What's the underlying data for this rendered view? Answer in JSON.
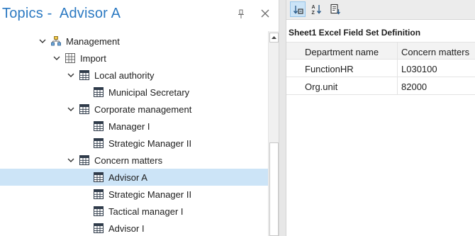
{
  "left_pane": {
    "title": "Topics -  Advisor A",
    "pin_icon": "pin-icon",
    "close_icon": "close-icon"
  },
  "tree": [
    {
      "label": "Management",
      "icon": "org-chart-icon",
      "expanded": true,
      "level": 0
    },
    {
      "label": "Import",
      "icon": "grid-icon",
      "expanded": true,
      "level": 1
    },
    {
      "label": "Local authority",
      "icon": "table-icon",
      "expanded": true,
      "level": 2
    },
    {
      "label": "Municipal Secretary",
      "icon": "table-icon",
      "level": 3
    },
    {
      "label": "Corporate management",
      "icon": "table-icon",
      "expanded": true,
      "level": 2
    },
    {
      "label": "Manager I",
      "icon": "table-icon",
      "level": 3
    },
    {
      "label": "Strategic Manager II",
      "icon": "table-icon",
      "level": 3
    },
    {
      "label": "Concern matters",
      "icon": "table-icon",
      "expanded": true,
      "level": 2
    },
    {
      "label": "Advisor A",
      "icon": "table-icon",
      "level": 3,
      "selected": true
    },
    {
      "label": "Strategic Manager II",
      "icon": "table-icon",
      "level": 3
    },
    {
      "label": "Tactical manager I",
      "icon": "table-icon",
      "level": 3
    },
    {
      "label": "Advisor I",
      "icon": "table-icon",
      "level": 3
    }
  ],
  "toolbar": {
    "buttons": [
      {
        "icon": "categorized-sort-icon",
        "active": true
      },
      {
        "icon": "alphabetical-sort-icon"
      },
      {
        "icon": "property-pages-icon"
      }
    ]
  },
  "properties": {
    "caption": "Sheet1 Excel Field Set Definition",
    "header": [
      "Department name",
      "Concern matters"
    ],
    "rows": [
      [
        "FunctionHR",
        "L030100"
      ],
      [
        "Org.unit",
        "82000"
      ]
    ]
  },
  "colors": {
    "title": "#2b79c2",
    "selection": "#cce4f7",
    "toolbar": "#ececec"
  }
}
